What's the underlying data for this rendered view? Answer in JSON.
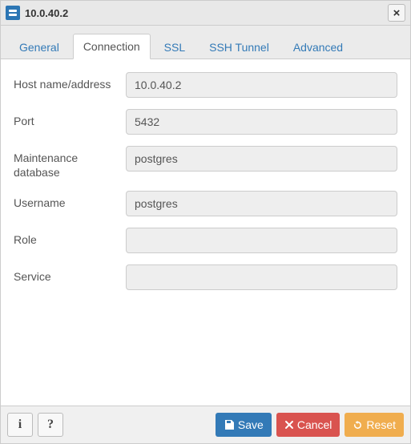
{
  "title": "10.0.40.2",
  "tabs": {
    "general": "General",
    "connection": "Connection",
    "ssl": "SSL",
    "ssh": "SSH Tunnel",
    "advanced": "Advanced"
  },
  "active_tab": "connection",
  "labels": {
    "host": "Host name/address",
    "port": "Port",
    "maintenance_db": "Maintenance database",
    "username": "Username",
    "role": "Role",
    "service": "Service"
  },
  "values": {
    "host": "10.0.40.2",
    "port": "5432",
    "maintenance_db": "postgres",
    "username": "postgres",
    "role": "",
    "service": ""
  },
  "buttons": {
    "save": "Save",
    "cancel": "Cancel",
    "reset": "Reset",
    "info": "i",
    "help": "?",
    "close": "×"
  }
}
